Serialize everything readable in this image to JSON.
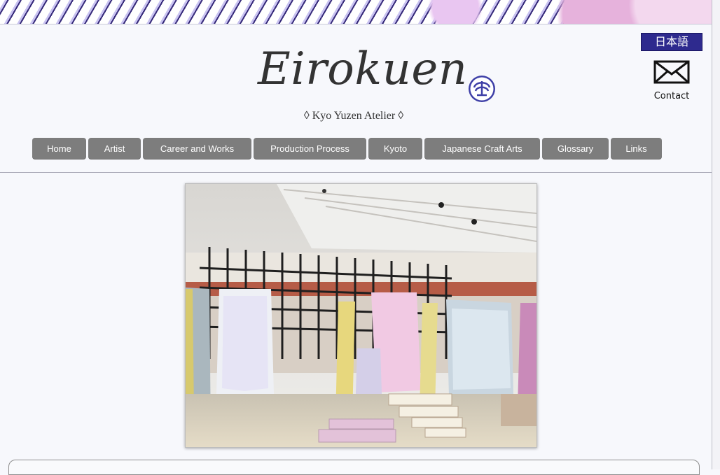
{
  "header": {
    "title": "Eirokuen",
    "subtitle": "◊ Kyo Yuzen Atelier ◊",
    "language_button": "日本語",
    "contact_label": "Contact"
  },
  "nav": [
    {
      "label": "Home"
    },
    {
      "label": "Artist"
    },
    {
      "label": "Career and Works"
    },
    {
      "label": "Production Process"
    },
    {
      "label": "Kyoto"
    },
    {
      "label": "Japanese Craft Arts"
    },
    {
      "label": "Glossary"
    },
    {
      "label": "Links"
    }
  ],
  "colors": {
    "nav_button": "#7d7d7d",
    "language_button": "#2e2a8e",
    "crest": "#3e3fa7"
  },
  "icons": {
    "contact": "mail-envelope-icon",
    "crest": "family-crest-icon"
  }
}
